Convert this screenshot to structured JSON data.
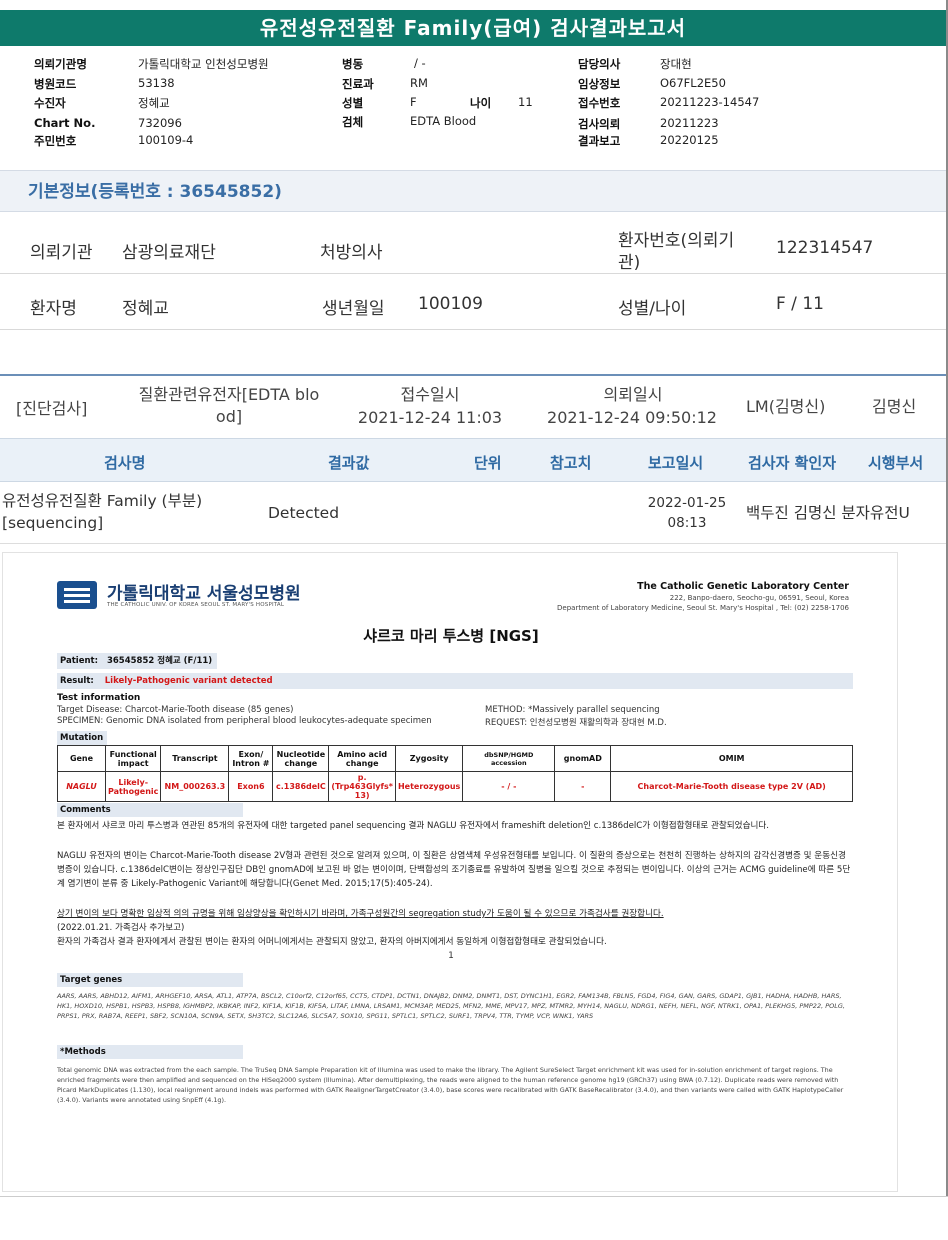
{
  "title": "유전성유전질환 Family(급여) 검사결과보고서",
  "header": {
    "rows": [
      [
        {
          "k": "의뢰기관명",
          "v": "가톨릭대학교 인천성모병원"
        },
        {
          "k": "병동",
          "v": "/ -"
        },
        {
          "k": "담당의사",
          "v": "장대현"
        }
      ],
      [
        {
          "k": "병원코드",
          "v": "53138"
        },
        {
          "k": "진료과",
          "v": "RM"
        },
        {
          "k": "임상정보",
          "v": "O67FL2E50"
        }
      ],
      [
        {
          "k": "수진자",
          "v": "정혜교"
        },
        {
          "k": "성별",
          "v": "F"
        },
        {
          "k": "접수번호",
          "v": "20211223-14547"
        }
      ],
      [
        {
          "k": "Chart No.",
          "v": "732096"
        },
        {
          "k": "검체",
          "v": "EDTA Blood"
        },
        {
          "k": "검사의뢰",
          "v": "20211223"
        }
      ],
      [
        {
          "k": "주민번호",
          "v": "100109-4"
        },
        {
          "k": "",
          "v": ""
        },
        {
          "k": "결과보고",
          "v": "20220125"
        }
      ]
    ],
    "age_label": "나이",
    "age_value": "11"
  },
  "basic": {
    "title": "기본정보(등록번호 : 36545852)",
    "row1": {
      "inst_label": "의뢰기관",
      "inst_value": "삼광의료재단",
      "doctor_label": "처방의사",
      "doctor_value": "",
      "pid_label_1": "환자번호(의뢰기",
      "pid_label_2": "관)",
      "pid_value": "122314547"
    },
    "row2": {
      "name_label": "환자명",
      "name_value": "정혜교",
      "birth_label": "생년월일",
      "birth_value": "100109",
      "sex_label": "성별/나이",
      "sex_value": "F / 11"
    }
  },
  "order": {
    "category": "[진단검사]",
    "test_1": "질환관련유전자[EDTA blo",
    "test_2": "od]",
    "received_label": "접수일시",
    "received_value": "2021-12-24  11:03",
    "requested_label": "의뢰일시",
    "requested_value": "2021-12-24  09:50:12",
    "lm": "LM(김명신)",
    "confirmer": "김명신"
  },
  "table": {
    "headers": [
      "검사명",
      "결과값",
      "단위",
      "참고치",
      "보고일시",
      "검사자 확인자",
      "시행부서"
    ],
    "row": {
      "name_1": "유전성유전질환 Family (부분)",
      "name_2": "[sequencing]",
      "result": "Detected",
      "report_date": "2022-01-25",
      "report_time": "08:13",
      "staff": "백두진 김명신 분자유전U"
    }
  },
  "report": {
    "hospital": "가톨릭대학교 서울성모병원",
    "hospital_sub": "THE CATHOLIC UNIV. OF KOREA SEOUL ST. MARY'S HOSPITAL",
    "lab_name": "The Catholic Genetic Laboratory Center",
    "lab_addr": "222, Banpo-daero, Seocho-gu, 06591, Seoul, Korea",
    "lab_dept": "Department of Laboratory Medicine, Seoul St. Mary's Hospital , Tel: (02) 2258-1706",
    "doc_title": "샤르코 마리 투스병 [NGS]",
    "patient_label": "Patient:",
    "patient_value": "36545852 정혜교 (F/11)",
    "result_label": "Result:",
    "result_value": "Likely-Pathogenic variant detected",
    "test_info_label": "Test information",
    "target_disease": "Target Disease: Charcot-Marie-Tooth disease (85 genes)",
    "specimen": "SPECIMEN: Genomic DNA isolated from peripheral blood leukocytes-adequate specimen",
    "method": "METHOD: *Massively parallel sequencing",
    "request": "REQUEST: 인천성모병원 재활의학과 장대현 M.D.",
    "mutation_label": "Mutation",
    "mut_headers": [
      "Gene",
      "Functional impact",
      "Transcript",
      "Exon/ Intron #",
      "Nucleotide change",
      "Amino acid change",
      "Zygosity",
      "dbSNP/HGMD accession",
      "gnomAD",
      "OMIM"
    ],
    "mut_row": [
      "NAGLU",
      "Likely-Pathogenic",
      "NM_000263.3",
      "Exon6",
      "c.1386delC",
      "p.(Trp463Glyfs* 13)",
      "Heterozygous",
      "- / -",
      "-",
      "Charcot-Marie-Tooth disease type 2V (AD)"
    ],
    "comments_label": "Comments",
    "comment_1": "본 환자에서 샤르코 마리 투스병과 연관된 85개의 유전자에 대한 targeted panel sequencing 결과 NAGLU 유전자에서 frameshift deletion인 c.1386delC가 이형접합형태로 관찰되었습니다.",
    "comment_2": "NAGLU 유전자의 변이는 Charcot-Marie-Tooth disease 2V형과 관련된 것으로 알려져 있으며, 이 질환은 상염색체 우성유전형태를 보입니다. 이 질환의 증상으로는 천천히 진행하는 상하지의 감각신경병증 및 운동신경병증이 있습니다. c.1386delC변이는 정상인구집단 DB인 gnomAD에 보고된 바 없는 변이이며, 단백합성의 조기종료를 유발하여 질병을 일으킬 것으로 추정되는 변이입니다. 이상의 근거는 ACMG guideline에 따른 5단계 염기변이 분류 중 Likely-Pathogenic Variant에 해당합니다(Genet Med. 2015;17(5):405-24).",
    "comment_3": "상기 변이의 보다 명확한 임상적 의의 규명을 위해 임상양상을 확인하시기 바라며, 가족구성원간의 segregation study가 도움이 될 수 있으므로 가족검사를 권장합니다.",
    "comment_4": "(2022.01.21. 가족검사 추가보고)",
    "comment_5": "환자의 가족검사 결과 환자에게서 관찰된 변이는 환자의 어머니에게서는 관찰되지 않았고, 환자의 아버지에게서 동일하게 이형접합형태로 관찰되었습니다.",
    "target_genes_label": "Target genes",
    "target_genes": "AARS, AARS, ABHD12, AIFM1, ARHGEF10, ARSA, ATL1, ATP7A, BSCL2, C10orf2, C12orf65, CCT5, CTDP1, DCTN1, DNAJB2, DNM2, DNMT1, DST, DYNC1H1, EGR2, FAM134B, FBLN5, FGD4, FIG4, GAN, GARS, GDAP1, GJB1, HADHA, HADHB, HARS, HK1, HOXD10, HSPB1, HSPB3, HSPB8, IGHMBP2, IKBKAP, INF2, KIF1A, KIF1B, KIF5A, LITAF, LMNA, LRSAM1, MCM3AP, MED25, MFN2, MME, MPV17, MPZ, MTMR2, MYH14, NAGLU, NDRG1, NEFH, NEFL, NGF, NTRK1, OPA1, PLEKHG5, PMP22, POLG, PRPS1, PRX, RAB7A, REEP1, SBF2, SCN10A, SCN9A, SETX, SH3TC2, SLC12A6, SLC5A7, SOX10, SPG11, SPTLC1, SPTLC2, SURF1, TRPV4, TTR, TYMP, VCP, WNK1, YARS",
    "methods_label": "*Methods",
    "methods": "Total genomic DNA was extracted from the each sample.  The TruSeq DNA Sample Preparation kit of Illumina was used to make the library. The Agilent SureSelect Target enrichment kit was used for in-solution enrichment of target regions. The enriched fragments were then amplified and sequenced on the HiSeq2000 system (Illumina). After demultiplexing, the reads were aligned to the human reference genome hg19 (GRCh37) using BWA (0.7.12). Duplicate reads were removed with Picard MarkDuplicates (1.130), local realignment around indels was performed with GATK RealignerTargetCreator (3.4.0), base scores were recalibrated with GATK BaseRecalibrator (3.4.0), and then variants were called with GATK HaplotypeCaller (3.4.0). Variants were annotated using SnpEff (4.1g).",
    "page_number": "1"
  }
}
